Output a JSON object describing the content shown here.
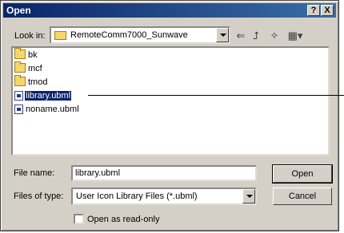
{
  "window": {
    "title": "Open",
    "help_label": "?",
    "close_label": "X"
  },
  "lookin": {
    "label": "Look in:",
    "value": "RemoteComm7000_Sunwave"
  },
  "toolbar": {
    "back_icon": "back-arrow-icon",
    "up_icon": "up-folder-icon",
    "new_folder_icon": "new-folder-icon",
    "views_icon": "views-menu-icon"
  },
  "files": [
    {
      "name": "bk",
      "type": "folder"
    },
    {
      "name": "mcf",
      "type": "folder"
    },
    {
      "name": "tmod",
      "type": "folder"
    },
    {
      "name": "library.ubml",
      "type": "file",
      "selected": true
    },
    {
      "name": "noname.ubml",
      "type": "file"
    }
  ],
  "filename": {
    "label": "File name:",
    "value": "library.ubml"
  },
  "filetype": {
    "label": "Files of type:",
    "value": "User Icon Library Files (*.ubml)"
  },
  "buttons": {
    "open": "Open",
    "cancel": "Cancel"
  },
  "readonly": {
    "label": "Open as read-only"
  }
}
